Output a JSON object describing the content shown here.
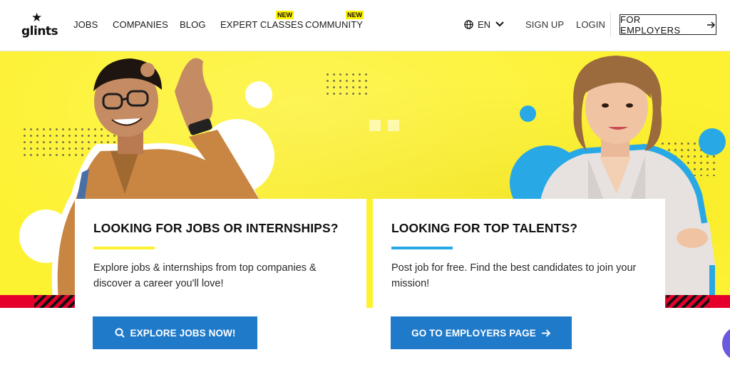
{
  "header": {
    "logo_text": "glints",
    "nav": [
      {
        "label": "JOBS"
      },
      {
        "label": "COMPANIES"
      },
      {
        "label": "BLOG"
      },
      {
        "label": "EXPERT CLASSES",
        "badge": "NEW"
      },
      {
        "label": "COMMUNITY",
        "badge": "NEW"
      }
    ],
    "language": "EN",
    "sign_up": "SIGN UP",
    "login": "LOGIN",
    "for_employers": "FOR EMPLOYERS"
  },
  "cards": {
    "jobseeker": {
      "title": "LOOKING FOR JOBS OR INTERNSHIPS?",
      "description": "Explore jobs & internships from top companies & discover a career you'll love!",
      "cta": "EXPLORE JOBS NOW!",
      "accent": "#fdf232"
    },
    "employer": {
      "title": "LOOKING FOR TOP TALENTS?",
      "description": "Post job for free. Find the best candidates to join your mission!",
      "cta": "GO TO EMPLOYERS PAGE",
      "accent": "#29a8e6"
    }
  },
  "icons": {
    "logo": "star-icon",
    "language": "globe-icon",
    "language_toggle": "chevron-down-icon",
    "employers_arrow": "arrow-right-icon",
    "explore_search": "search-icon",
    "employers_cta_arrow": "arrow-right-icon"
  },
  "colors": {
    "hero_background": "#fdf232",
    "primary_button": "#1f7ac9",
    "hero_stripe": "#e4002b",
    "new_badge": "#fff200"
  }
}
